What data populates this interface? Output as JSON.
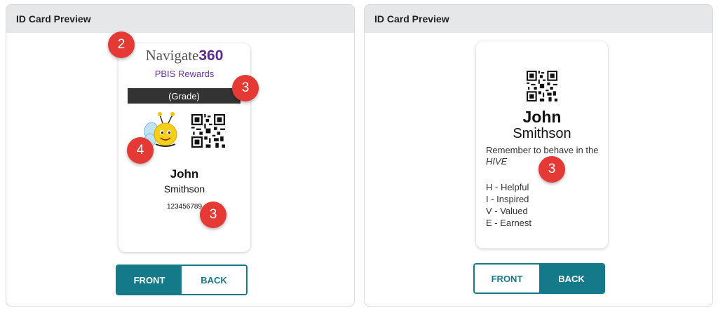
{
  "left_panel": {
    "header": "ID Card Preview",
    "card": {
      "logo_text": "Navigate",
      "logo_num": "360",
      "subtitle": "PBIS Rewards",
      "grade": "(Grade)",
      "mascot_icon": "bee-mascot-icon",
      "qr_icon": "qr-code-icon",
      "first_name": "John",
      "last_name": "Smithson",
      "id_number": "123456789"
    },
    "toggle": {
      "front_label": "FRONT",
      "back_label": "BACK",
      "active": "FRONT"
    }
  },
  "right_panel": {
    "header": "ID Card Preview",
    "card": {
      "qr_icon": "qr-code-icon",
      "first_name": "John",
      "last_name": "Smithson",
      "motto_pre": "Remember to behave in the ",
      "motto_em": "HIVE",
      "values": [
        "H - Helpful",
        "I - Inspired",
        "V - Valued",
        "E - Earnest"
      ]
    },
    "toggle": {
      "front_label": "FRONT",
      "back_label": "BACK",
      "active": "BACK"
    }
  },
  "badges": [
    "2",
    "3",
    "4",
    "3",
    "3"
  ],
  "colors": {
    "accent": "#147a8a",
    "badge": "#e53935",
    "brand_purple": "#5b2d8e",
    "header_bg": "#e6e7e8"
  }
}
